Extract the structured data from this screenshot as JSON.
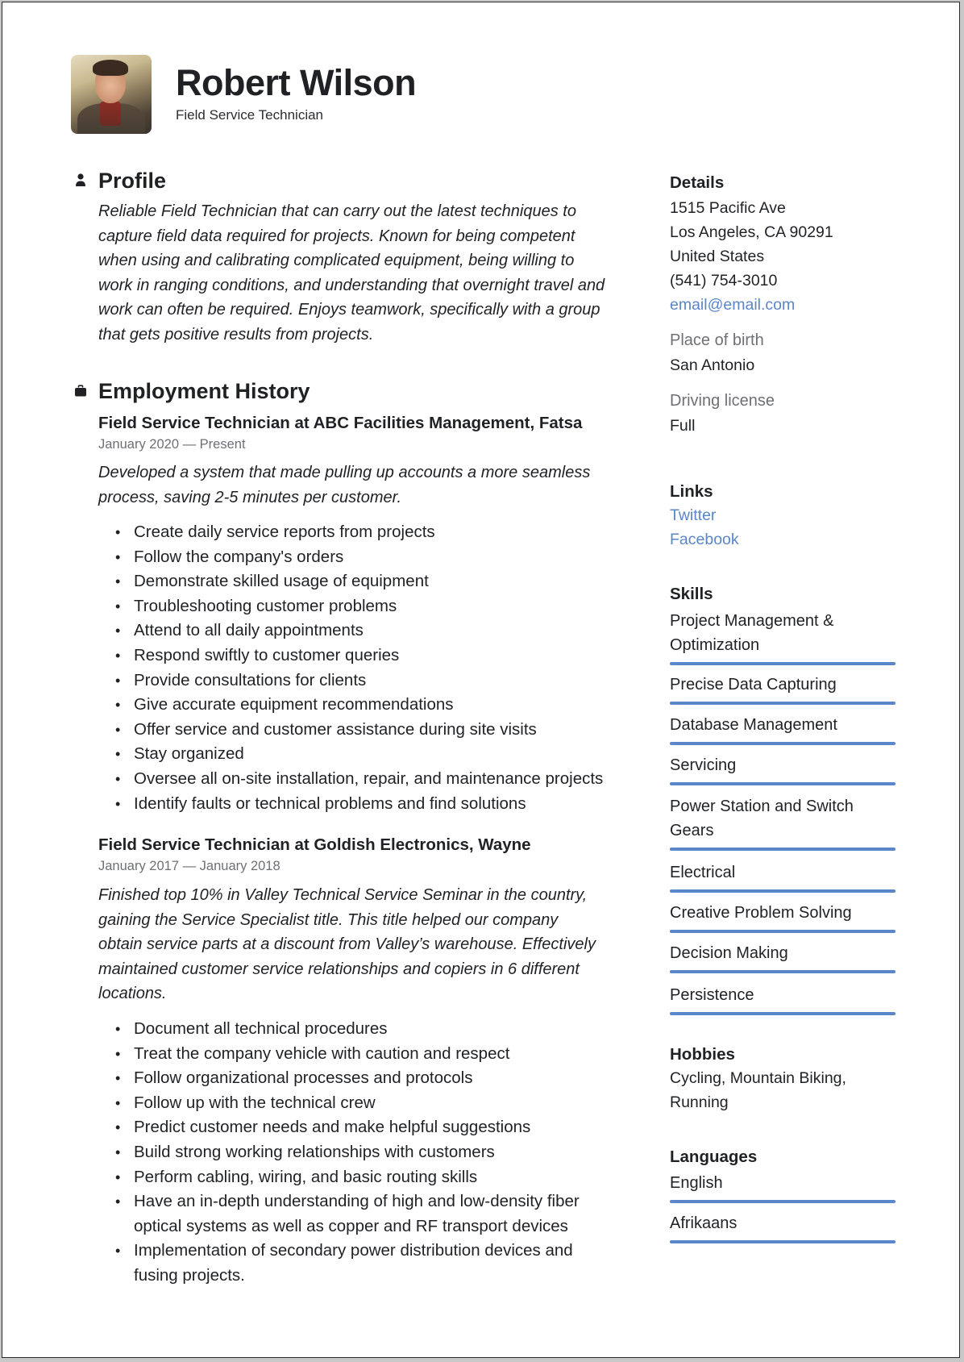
{
  "header": {
    "name": "Robert Wilson",
    "title": "Field Service Technician"
  },
  "profile": {
    "heading": "Profile",
    "icon": "person-icon",
    "text_lines": [
      "Reliable Field Technician that can carry out the latest techniques to",
      "capture field data required for projects. Known for being competent",
      "when using and calibrating complicated equipment, being willing to",
      "work in ranging conditions, and understanding that overnight travel and",
      "work can often be required. Enjoys teamwork, specifically with a group",
      "that gets positive results from projects."
    ]
  },
  "employment": {
    "heading": "Employment History",
    "icon": "briefcase-icon",
    "jobs": [
      {
        "title": "Field Service Technician at ABC Facilities Management, Fatsa",
        "dates": "January 2020 — Present",
        "summary_lines": [
          "Developed a system that made pulling up accounts a more seamless",
          "process, saving 2-5 minutes per customer."
        ],
        "bullets": [
          "Create daily service reports from projects",
          "Follow the company's orders",
          "Demonstrate skilled usage of equipment",
          "Troubleshooting customer problems",
          "Attend to all daily appointments",
          "Respond swiftly to customer queries",
          "Provide consultations for clients",
          "Give accurate equipment recommendations",
          "Offer service and customer assistance during site visits",
          "Stay organized",
          "Oversee all on-site installation, repair, and maintenance projects",
          "Identify faults or technical problems and find solutions"
        ]
      },
      {
        "title": "Field Service Technician at Goldish Electronics, Wayne",
        "dates": "January 2017 — January 2018",
        "summary_lines": [
          "Finished top 10% in Valley Technical Service Seminar in the country,",
          "gaining the Service Specialist title. This title helped our company",
          "obtain service parts at a discount from Valley’s warehouse. Effectively",
          "maintained customer service relationships and copiers in 6 different",
          "locations."
        ],
        "bullets": [
          "Document all technical procedures",
          "Treat the company vehicle with caution and respect",
          "Follow organizational processes and protocols",
          "Follow up with the technical crew",
          "Predict customer needs and make helpful suggestions",
          "Build strong working relationships with customers",
          "Perform cabling, wiring, and basic routing skills",
          "Have an in-depth understanding of high and low-density fiber optical systems as well as copper and RF transport devices",
          "Implementation of secondary power distribution devices and fusing projects."
        ]
      }
    ]
  },
  "details": {
    "heading": "Details",
    "address_line1": "1515 Pacific Ave",
    "address_line2": "Los Angeles, CA 90291",
    "country": "United States",
    "phone": "(541) 754-3010",
    "email": "email@email.com",
    "place_of_birth_label": "Place of birth",
    "place_of_birth": "San Antonio",
    "driving_license_label": "Driving license",
    "driving_license": "Full"
  },
  "links": {
    "heading": "Links",
    "items": [
      "Twitter",
      "Facebook"
    ]
  },
  "skills": {
    "heading": "Skills",
    "items": [
      {
        "label": "Project Management & Optimization",
        "level": 1.0
      },
      {
        "label": "Precise Data Capturing",
        "level": 1.0
      },
      {
        "label": "Database Management",
        "level": 1.0
      },
      {
        "label": "Servicing",
        "level": 1.0
      },
      {
        "label": "Power Station and Switch Gears",
        "level": 1.0
      },
      {
        "label": "Electrical",
        "level": 1.0
      },
      {
        "label": "Creative Problem Solving",
        "level": 1.0
      },
      {
        "label": "Decision Making",
        "level": 1.0
      },
      {
        "label": "Persistence",
        "level": 1.0
      }
    ]
  },
  "hobbies": {
    "heading": "Hobbies",
    "text": "Cycling, Mountain Biking, Running"
  },
  "languages": {
    "heading": "Languages",
    "items": [
      {
        "label": "English",
        "level": 1.0
      },
      {
        "label": "Afrikaans",
        "level": 1.0
      }
    ]
  },
  "colors": {
    "accent": "#5b86c9",
    "link": "#5a86c8",
    "muted": "#6e7074",
    "text": "#1f2124"
  }
}
